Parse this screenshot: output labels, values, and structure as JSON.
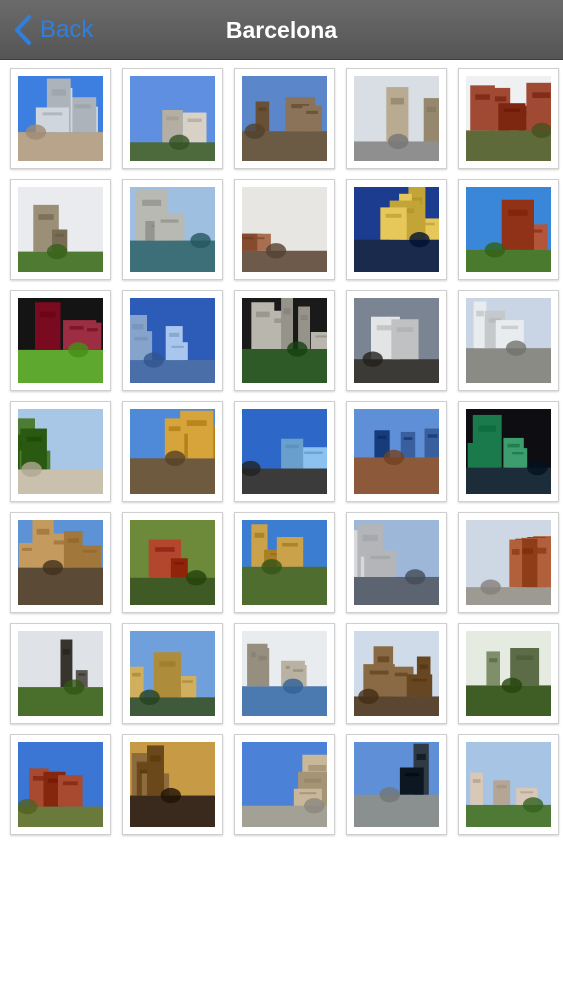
{
  "navbar": {
    "back_label": "Back",
    "title": "Barcelona",
    "back_icon": "chevron-left-icon"
  },
  "photos": [
    {
      "subject": "twin-towers",
      "sky": "#3d7fe0",
      "ground": "#b7a48a",
      "accent": "#cfd6de"
    },
    {
      "subject": "hotel-towers",
      "sky": "#5f8fe0",
      "ground": "#4d6a3c",
      "accent": "#d8d2c6"
    },
    {
      "subject": "gothic-church",
      "sky": "#5b86c9",
      "ground": "#6b5a44",
      "accent": "#8a7358"
    },
    {
      "subject": "palace-palms",
      "sky": "#d9dde4",
      "ground": "#8f8f8f",
      "accent": "#b8ab92"
    },
    {
      "subject": "brick-castle",
      "sky": "#eef0f2",
      "ground": "#5e6a3a",
      "accent": "#a04a34"
    },
    {
      "subject": "fortress-garden",
      "sky": "#e9ebee",
      "ground": "#4f7a32",
      "accent": "#9b8f78"
    },
    {
      "subject": "city-panorama",
      "sky": "#9fbfe0",
      "ground": "#3d6f78",
      "accent": "#b7b9b2"
    },
    {
      "subject": "stone-buildings",
      "sky": "#e8e6e2",
      "ground": "#6e5a4a",
      "accent": "#a86e52"
    },
    {
      "subject": "night-fountain",
      "sky": "#1c3c8f",
      "ground": "#1a2a4c",
      "accent": "#e5c75a"
    },
    {
      "subject": "park-wall",
      "sky": "#3a86d8",
      "ground": "#4a7a2e",
      "accent": "#b2553a"
    },
    {
      "subject": "football-stadium",
      "sky": "#141414",
      "ground": "#5fa82f",
      "accent": "#9c2d43"
    },
    {
      "subject": "glass-tower",
      "sky": "#2c5cb8",
      "ground": "#4a6ea8",
      "accent": "#a9c6ee"
    },
    {
      "subject": "rock-mountain",
      "sky": "#1a1a1a",
      "ground": "#2e5a28",
      "accent": "#b9b6ae"
    },
    {
      "subject": "skyscraper",
      "sky": "#7a8492",
      "ground": "#3c3a36",
      "accent": "#e2e4e6"
    },
    {
      "subject": "modern-pavilion",
      "sky": "#c9d5e4",
      "ground": "#8b8b86",
      "accent": "#e8ecef"
    },
    {
      "subject": "tree-lined-avenue",
      "sky": "#a8c7e6",
      "ground": "#c9c1ad",
      "accent": "#4d7d34"
    },
    {
      "subject": "colorful-sculpture",
      "sky": "#4f8ad8",
      "ground": "#6e5a3e",
      "accent": "#d6a43a"
    },
    {
      "subject": "aquarium-blue",
      "sky": "#2d68c8",
      "ground": "#3b3b3b",
      "accent": "#8cc2ef"
    },
    {
      "subject": "bullet-tower",
      "sky": "#5f8fd6",
      "ground": "#8c5a3a",
      "accent": "#3a5f9e"
    },
    {
      "subject": "christmas-tree",
      "sky": "#0e0e12",
      "ground": "#1c2c38",
      "accent": "#3d9d6e"
    },
    {
      "subject": "ornate-facade",
      "sky": "#5d93d6",
      "ground": "#5a4a36",
      "accent": "#c49a5e"
    },
    {
      "subject": "red-building-trees",
      "sky": "#6c8a3a",
      "ground": "#3f5a24",
      "accent": "#b2472e"
    },
    {
      "subject": "tiled-palace",
      "sky": "#3b7ed1",
      "ground": "#4f6d2e",
      "accent": "#c9a24a"
    },
    {
      "subject": "reflecting-pool",
      "sky": "#9cb7d8",
      "ground": "#5c6472",
      "accent": "#d6d8dc"
    },
    {
      "subject": "basilica-plaza",
      "sky": "#cdd8e4",
      "ground": "#9d9a94",
      "accent": "#b2603c"
    },
    {
      "subject": "statue-garden",
      "sky": "#dfe3e8",
      "ground": "#4a6f2c",
      "accent": "#5a5650"
    },
    {
      "subject": "palace-lake",
      "sky": "#6fa0dc",
      "ground": "#3f5a3a",
      "accent": "#d0b05e"
    },
    {
      "subject": "fountain-square",
      "sky": "#e9ecef",
      "ground": "#4a7ab0",
      "accent": "#b9b1a2"
    },
    {
      "subject": "cathedral-spires",
      "sky": "#cfdbe9",
      "ground": "#5b4631",
      "accent": "#8a6a44"
    },
    {
      "subject": "mountain-cliff",
      "sky": "#e6ebe2",
      "ground": "#3e5e26",
      "accent": "#7f8f6a"
    },
    {
      "subject": "castle-tower",
      "sky": "#3c76d4",
      "ground": "#6a7a3a",
      "accent": "#a84a30"
    },
    {
      "subject": "mosaic-face",
      "sky": "#c79b46",
      "ground": "#3a2a1e",
      "accent": "#8d6b3c"
    },
    {
      "subject": "museum-palms",
      "sky": "#4b82d8",
      "ground": "#a3a096",
      "accent": "#c9b79a"
    },
    {
      "subject": "tower-square",
      "sky": "#5f8fd6",
      "ground": "#8a8f90",
      "accent": "#2f3a44"
    },
    {
      "subject": "city-gardens",
      "sky": "#a8c4e4",
      "ground": "#4e7a36",
      "accent": "#d8c8b8"
    }
  ]
}
